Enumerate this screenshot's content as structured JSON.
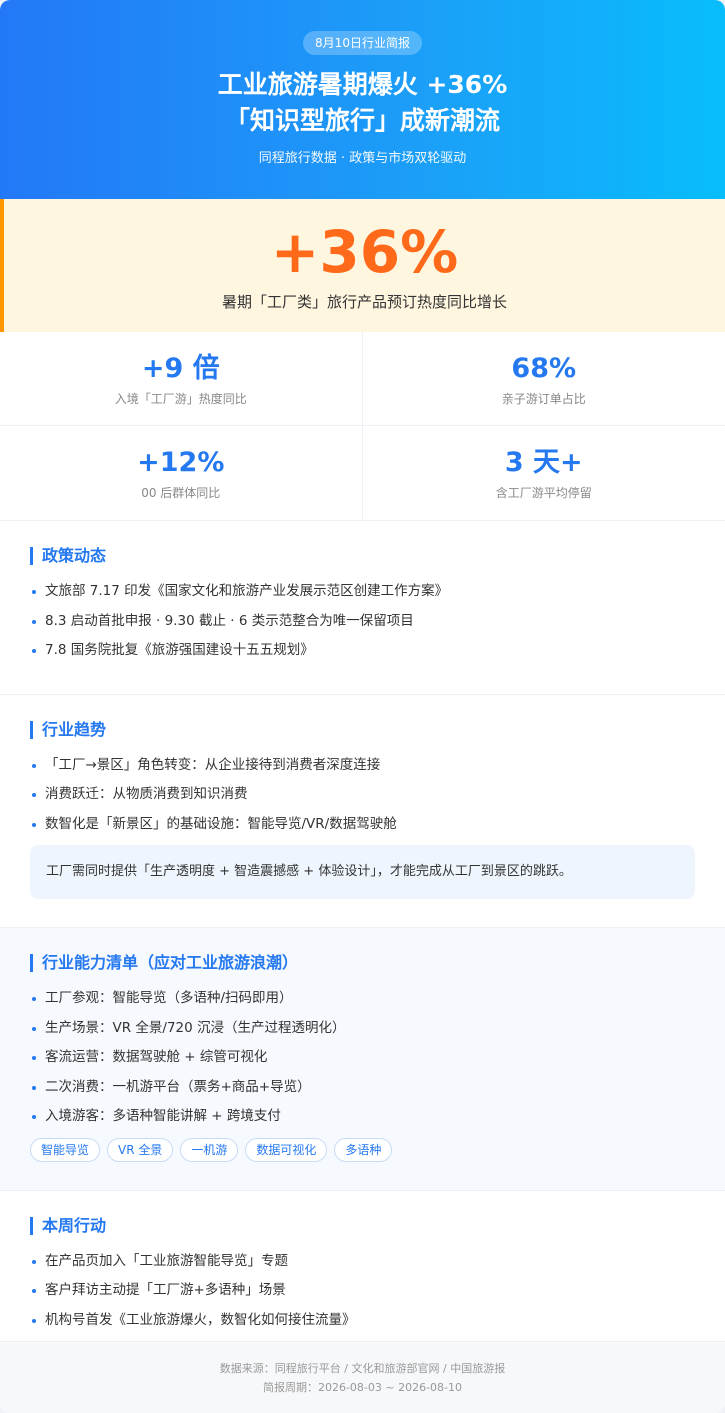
{
  "header": {
    "badge": "8月10日行业简报",
    "title_line1": "工业旅游暑期爆火 +36%",
    "title_line2": "「知识型旅行」成新潮流",
    "subtitle": "同程旅行数据 · 政策与市场双轮驱动"
  },
  "highlight": {
    "value": "+36%",
    "desc": "暑期「工厂类」旅行产品预订热度同比增长"
  },
  "stats": [
    {
      "value": "+9 倍",
      "label": "入境「工厂游」热度同比"
    },
    {
      "value": "68%",
      "label": "亲子游订单占比"
    },
    {
      "value": "+12%",
      "label": "00 后群体同比"
    },
    {
      "value": "3 天+",
      "label": "含工厂游平均停留"
    }
  ],
  "policy": {
    "title": "政策动态",
    "items": [
      "文旅部 7.17 印发《国家文化和旅游产业发展示范区创建工作方案》",
      "8.3 启动首批申报 · 9.30 截止 · 6 类示范整合为唯一保留项目",
      "7.8 国务院批复《旅游强国建设十五五规划》"
    ]
  },
  "trends": {
    "title": "行业趋势",
    "items": [
      "「工厂→景区」角色转变：从企业接待到消费者深度连接",
      "消费跃迁：从物质消费到知识消费",
      "数智化是「新景区」的基础设施：智能导览/VR/数据驾驶舱"
    ],
    "note": "工厂需同时提供「生产透明度 + 智造震撼感 + 体验设计」，才能完成从工厂到景区的跳跃。"
  },
  "capabilities": {
    "title": "行业能力清单（应对工业旅游浪潮）",
    "items": [
      "工厂参观：智能导览（多语种/扫码即用）",
      "生产场景：VR 全景/720 沉浸（生产过程透明化）",
      "客流运营：数据驾驶舱 + 综管可视化",
      "二次消费：一机游平台（票务+商品+导览）",
      "入境游客：多语种智能讲解 + 跨境支付"
    ],
    "tags": [
      "智能导览",
      "VR 全景",
      "一机游",
      "数据可视化",
      "多语种"
    ]
  },
  "actions": {
    "title": "本周行动",
    "items": [
      "在产品页加入「工业旅游智能导览」专题",
      "客户拜访主动提「工厂游+多语种」场景",
      "机构号首发《工业旅游爆火，数智化如何接住流量》"
    ]
  },
  "footer": {
    "source": "数据来源：同程旅行平台 / 文化和旅游部官网 / 中国旅游报",
    "period": "简报周期：2026-08-03 ~ 2026-08-10"
  },
  "colors": {
    "accent": "#2478f0",
    "highlight": "#ff6a1a",
    "highlight_bg": "#fff6e0"
  }
}
